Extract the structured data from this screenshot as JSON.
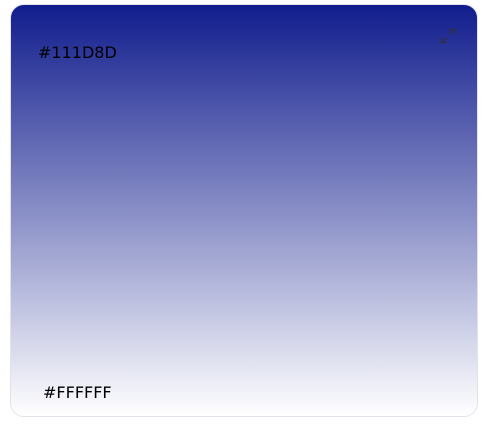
{
  "gradient": {
    "start_color": "#111D8D",
    "end_color": "#FFFFFF",
    "start_label": "#111D8D",
    "end_label": "#FFFFFF",
    "direction": "top-to-bottom"
  },
  "expand_button": {
    "icon": "expand-arrows-icon",
    "icon_color": "#2b3250"
  }
}
